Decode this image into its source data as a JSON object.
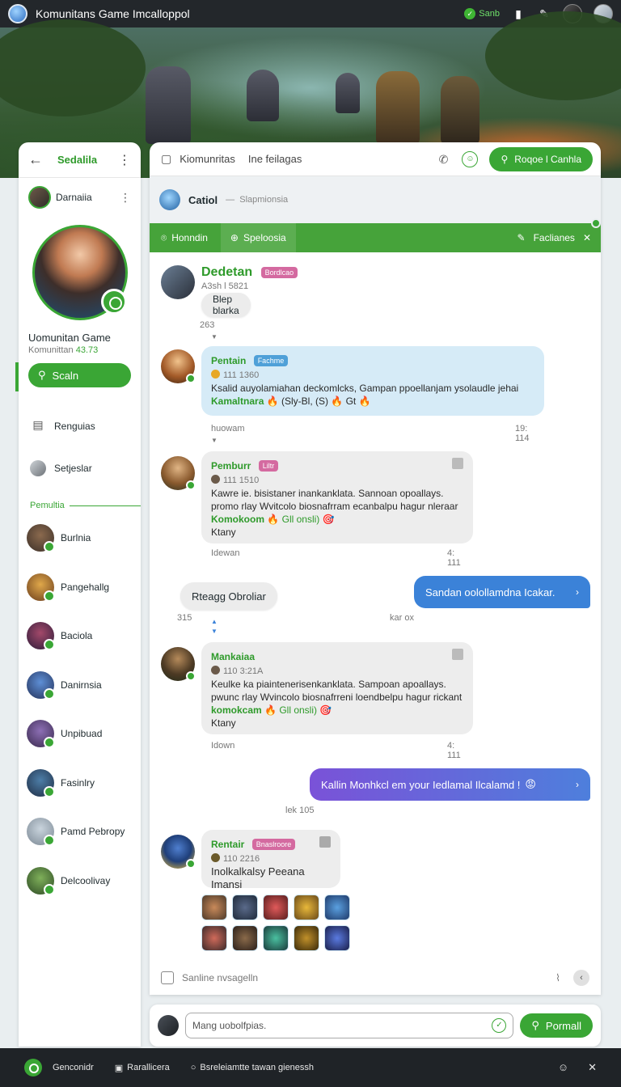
{
  "topbar": {
    "title": "Komunitans Game Imcalloppol",
    "status_label": "Sanb"
  },
  "sidebar": {
    "header_label": "Sedalila",
    "user_name": "Darnaiia",
    "community_title": "Uomunitan Game",
    "community_sub": "Komunittan",
    "community_count": "43.73",
    "search_label": "Scaln",
    "menu": [
      {
        "label": "Renguias",
        "icon": "list-icon"
      },
      {
        "label": "Setjeslar",
        "icon": "avatar-icon"
      }
    ],
    "section_label": "Pemultia",
    "members": [
      {
        "name": "Burlnia",
        "color1": "#8b6a4e",
        "color2": "#3b2f28"
      },
      {
        "name": "Pangehallg",
        "color1": "#e0a84a",
        "color2": "#6a3d1d"
      },
      {
        "name": "Baciola",
        "color1": "#a3496a",
        "color2": "#2d1c3a"
      },
      {
        "name": "Danirnsia",
        "color1": "#5e8fd6",
        "color2": "#24325a"
      },
      {
        "name": "Unpibuad",
        "color1": "#8d6fb5",
        "color2": "#39294d"
      },
      {
        "name": "Fasinlry",
        "color1": "#4d7ea8",
        "color2": "#1f2d44"
      },
      {
        "name": "Pamd Pebropy",
        "color1": "#c9d4dd",
        "color2": "#7b8894"
      },
      {
        "name": "Delcoolivay",
        "color1": "#7fb05a",
        "color2": "#2d4a25"
      }
    ]
  },
  "chat": {
    "header_label": "Kiomunritas",
    "header_sub": "Ine feilagas",
    "header_button": "Roqoe l Canhla",
    "channel_name": "Catiol",
    "channel_sub": "Slapmionsia",
    "tabs": {
      "tab1": "Honndin",
      "tab2": "Speloosia",
      "right": "Faclianes"
    },
    "messages": {
      "m1": {
        "name": "Dedetan",
        "tag": "Bordlcao",
        "meta": "A3sh l 5821",
        "text": "Blep blarka",
        "under": "263"
      },
      "m2": {
        "name": "Pentain",
        "tag": "Fachme",
        "meta": "111 1360",
        "line1": "Ksalid auyolamiahan deckomlcks, Gampan ppoellanjam ysolaudle jehai",
        "green": "Kamaltnara",
        "rest": "(Sly-Bl, (S)",
        "rest2": "Gt",
        "left": "huowam",
        "time": "19: 114"
      },
      "m3": {
        "name": "Pemburr",
        "tag": "Liltr",
        "meta": "111 1510",
        "line1": "Kawre ie. bisistaner inankanklata. Sannoan opoallays.",
        "line2": "promo rlay Wvitcolo biosnafrram ecanbalpu hagur nleraar",
        "green": "Komokoom",
        "rest": "Gll onsli)",
        "line4": "Ktany",
        "left": "Idewan",
        "time": "4: 111"
      },
      "pill": "Rteagg Obroliar",
      "out1": "Sandan oolollamdna Icakar.",
      "left_small": "315",
      "mid_small": "kar ox",
      "m4": {
        "name": "Mankaiaa",
        "meta": "110 3:21A",
        "line1": "Keulke ka piaintenerisenkanklata. Sampoan apoallays.",
        "line2": "pwunc rlay Wvincolo biosnafrreni loendbelpu hagur rickant",
        "green": "komokcam",
        "rest": "Gll onsli)",
        "line4": "Ktany",
        "left": "Idown",
        "time": "4: 111"
      },
      "out2": "Kallin Monhkcl em your Iedlamal Ilcalamd !",
      "under_out2": "lek 105",
      "m5": {
        "name": "Rentair",
        "tag": "Bnaslroore",
        "meta": "110 2216",
        "text": "Inolkalkalsy Peeana Imansi"
      }
    },
    "footer_placeholder": "Sanline nvsagelln"
  },
  "composer": {
    "placeholder": "Mang uobolfpias.",
    "send_label": "Pormall"
  },
  "bottombar": {
    "brand": "Genconidr",
    "item1": "Rarallicera",
    "item2": "Bsreleiamtte tawan gienessh"
  },
  "colors": {
    "accent": "#3aa635",
    "dark_bar": "#23272b",
    "out_bubble_blue": "#3b7fd8",
    "out_bubble_purple": "#6a55d8"
  }
}
